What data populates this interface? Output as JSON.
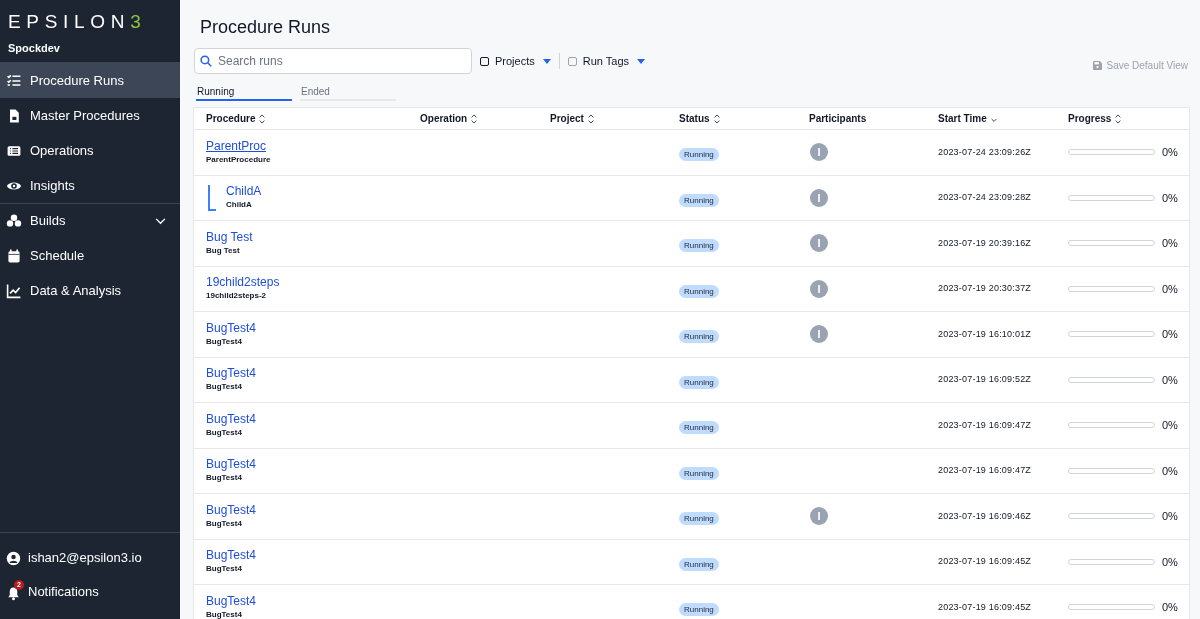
{
  "sidebar": {
    "logo": "EPSILON",
    "logo_mark": "3",
    "workspace": "Spockdev",
    "items": [
      {
        "label": "Procedure Runs",
        "selected": true
      },
      {
        "label": "Master Procedures",
        "selected": false
      },
      {
        "label": "Operations",
        "selected": false
      },
      {
        "label": "Insights",
        "selected": false
      },
      {
        "label": "Builds",
        "selected": false,
        "expanded": false
      },
      {
        "label": "Schedule",
        "selected": false
      },
      {
        "label": "Data & Analysis",
        "selected": false
      }
    ],
    "user": "ishan2@epsilon3.io",
    "notifications": {
      "label": "Notifications",
      "count": "2"
    }
  },
  "title": "Procedure Runs",
  "search": {
    "placeholder": "Search runs"
  },
  "filters": [
    {
      "label": "Projects",
      "checked": false
    },
    {
      "label": "Run Tags",
      "checked": false
    }
  ],
  "save_view": "Save Default View",
  "tabs": [
    {
      "label": "Running",
      "selected": true
    },
    {
      "label": "Ended",
      "selected": false
    }
  ],
  "table": {
    "columns": [
      {
        "label": "Procedure",
        "kind": "sortable"
      },
      {
        "label": "Operation",
        "kind": "sortable"
      },
      {
        "label": "Project",
        "kind": "sortable"
      },
      {
        "label": "Status",
        "kind": "sortable"
      },
      {
        "label": "Participants",
        "kind": "plain"
      },
      {
        "label": "Start Time",
        "kind": "sorted"
      },
      {
        "label": "Progress",
        "kind": "sortable"
      }
    ],
    "rows": [
      {
        "name": "ParentProc",
        "procedure": "ParentProcedure",
        "status": "Running",
        "participant": "I",
        "start_time": "2023-07-24 23:09:26Z",
        "level": 0,
        "progress": "0%",
        "hovered": true,
        "children": [
          {
            "name": "ChildA",
            "procedure": "ChildA",
            "status": "Running",
            "participant": "I",
            "start_time": "2023-07-24 23:09:28Z",
            "level": 0,
            "progress": "0%",
            "hovered": false
          }
        ]
      },
      {
        "name": "Bug Test",
        "procedure": "Bug Test",
        "status": "Running",
        "participant": "I",
        "start_time": "2023-07-19 20:39:16Z",
        "level": 0,
        "progress": "0%",
        "hovered": false
      },
      {
        "name": "19child2steps",
        "procedure": "19child2steps-2",
        "status": "Running",
        "participant": "I",
        "start_time": "2023-07-19 20:30:37Z",
        "level": 0,
        "progress": "0%",
        "hovered": false
      },
      {
        "name": "BugTest4",
        "procedure": "BugTest4",
        "status": "Running",
        "participant": "I",
        "start_time": "2023-07-19 16:10:01Z",
        "level": 0,
        "progress": "0%",
        "hovered": false
      },
      {
        "name": "BugTest4",
        "procedure": "BugTest4",
        "status": "Running",
        "start_time": "2023-07-19 16:09:52Z",
        "level": 0,
        "progress": "0%",
        "hovered": false
      },
      {
        "name": "BugTest4",
        "procedure": "BugTest4",
        "status": "Running",
        "start_time": "2023-07-19 16:09:47Z",
        "level": 0,
        "progress": "0%",
        "hovered": false
      },
      {
        "name": "BugTest4",
        "procedure": "BugTest4",
        "status": "Running",
        "start_time": "2023-07-19 16:09:47Z",
        "level": 0,
        "progress": "0%",
        "hovered": false
      },
      {
        "name": "BugTest4",
        "procedure": "BugTest4",
        "status": "Running",
        "participant": "I",
        "start_time": "2023-07-19 16:09:46Z",
        "level": 0,
        "progress": "0%",
        "hovered": false
      },
      {
        "name": "BugTest4",
        "procedure": "BugTest4",
        "status": "Running",
        "start_time": "2023-07-19 16:09:45Z",
        "level": 0,
        "progress": "0%",
        "hovered": false
      },
      {
        "name": "BugTest4",
        "procedure": "BugTest4",
        "status": "Running",
        "start_time": "2023-07-19 16:09:45Z",
        "level": 0,
        "progress": "0%",
        "hovered": false
      }
    ]
  }
}
